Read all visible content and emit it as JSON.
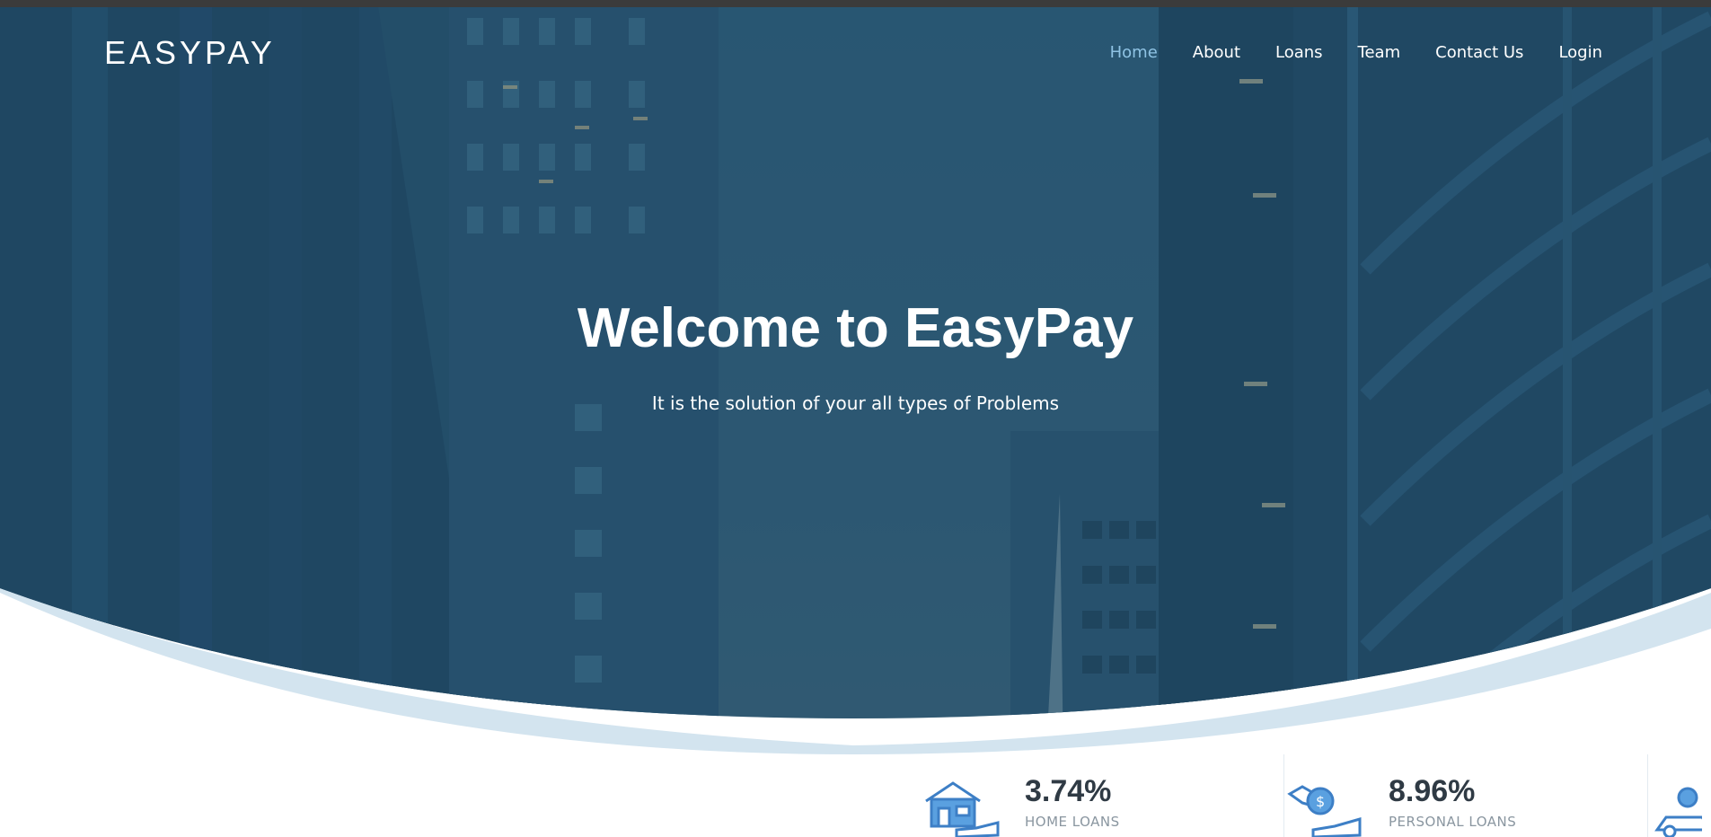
{
  "brand": {
    "name": "EASYPAY"
  },
  "nav": {
    "items": [
      {
        "label": "Home",
        "active": true
      },
      {
        "label": "About",
        "active": false
      },
      {
        "label": "Loans",
        "active": false
      },
      {
        "label": "Team",
        "active": false
      },
      {
        "label": "Contact Us",
        "active": false
      },
      {
        "label": "Login",
        "active": false
      }
    ]
  },
  "hero": {
    "title": "Welcome to EasyPay",
    "subtitle": "It is the solution of your all types of Problems"
  },
  "stats": [
    {
      "value": "3.74%",
      "label": "HOME LOANS",
      "icon": "house-in-hand-icon"
    },
    {
      "value": "8.96%",
      "label": "PERSONAL LOANS",
      "icon": "money-in-hand-icon"
    },
    {
      "value": "",
      "label": "",
      "icon": "car-loan-icon"
    }
  ],
  "colors": {
    "nav_active": "#8fc3e4",
    "hero_overlay": "#1f4a66",
    "wave_light": "#d3e4ef",
    "icon_blue": "#3d7fc6",
    "stat_value": "#2f3a44",
    "stat_label": "#8a96a0"
  }
}
